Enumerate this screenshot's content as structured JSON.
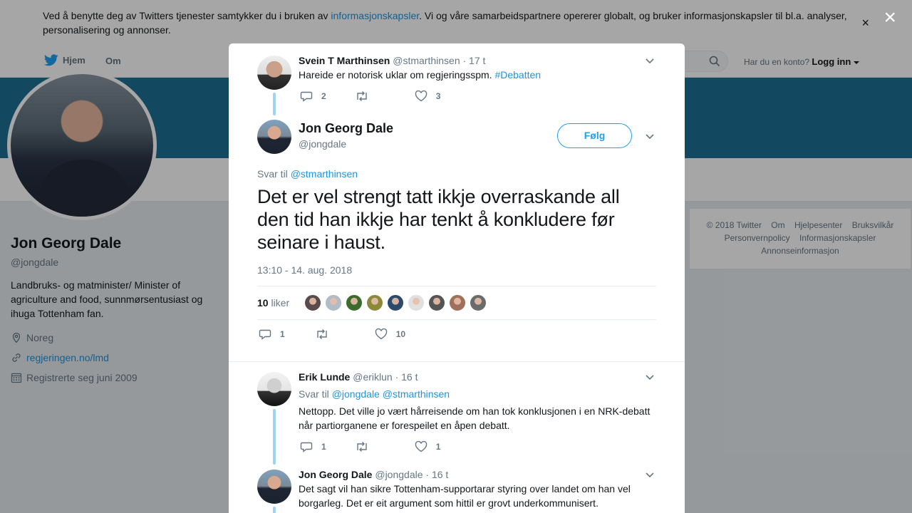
{
  "cookie_banner": {
    "text_before": "Ved å benytte deg av Twitters tjenester samtykker du i bruken av ",
    "link": "informasjonskapsler",
    "text_after": ". Vi og våre samarbeidspartnere opererer globalt, og bruker informasjonskapsler til bl.a. analyser, personalisering og annonser.",
    "close": "×"
  },
  "topnav": {
    "home": "Hjem",
    "about": "Om",
    "account_question": "Har du en konto?",
    "login": "Logg inn"
  },
  "profile": {
    "name": "Jon Georg Dale",
    "handle": "@jongdale",
    "bio": "Landbruks- og matminister/ Minister of agriculture and food, sunnmørsentusiast og ihuga Tottenham fan.",
    "location": "Noreg",
    "website": "regjeringen.no/lmd",
    "joined": "Registrerte seg juni 2009"
  },
  "footer": {
    "links": [
      "© 2018 Twitter",
      "Om",
      "Hjelpesenter",
      "Bruksvilkår",
      "Personvernpolicy",
      "Informasjonskapsler",
      "Annonseinformasjon"
    ]
  },
  "overlay_close": "×",
  "modal": {
    "parent_tweet": {
      "name": "Svein T Marthinsen",
      "handle": "@stmarthinsen",
      "time": "· 17 t",
      "text": "Hareide er notorisk uklar om regjeringsspm. ",
      "hashtag": "#Debatten",
      "replies": "2",
      "retweets": "",
      "likes": "3"
    },
    "main_tweet": {
      "name": "Jon Georg Dale",
      "handle": "@jongdale",
      "follow_label": "Følg",
      "reply_prefix": "Svar til ",
      "reply_to": "@stmarthinsen",
      "text": "Det er vel strengt tatt ikkje overraskande all den tid han ikkje har tenkt å konkludere før seinare i haust.",
      "timestamp": "13:10 - 14. aug. 2018",
      "like_count": "10",
      "like_label": " liker",
      "liker_colors": [
        "#5a4a4a",
        "#b0bcc6",
        "#3d6b2d",
        "#8a8a3a",
        "#2c4a6b",
        "#e0e0e0",
        "#555555",
        "#a0705a",
        "#6b6b6b"
      ],
      "replies": "1",
      "retweets": "",
      "likes": "10"
    },
    "reply_1": {
      "name": "Erik Lunde",
      "handle": "@eriklun",
      "time": "· 16 t",
      "reply_prefix": "Svar til ",
      "reply_to_1": "@jongdale",
      "reply_to_2": "@stmarthinsen",
      "text": "Nettopp. Det ville jo vært hårreisende om han tok konklusjonen i en NRK-debatt når partiorganene er forespeilet en åpen debatt.",
      "replies": "1",
      "retweets": "",
      "likes": "1"
    },
    "reply_2": {
      "name": "Jon Georg Dale",
      "handle": "@jongdale",
      "time": "· 16 t",
      "text": "Det sagt vil han sikre Tottenham-supportarar styring over landet om han vel borgarleg. Det er eit argument som hittil er grovt underkommunisert."
    }
  }
}
